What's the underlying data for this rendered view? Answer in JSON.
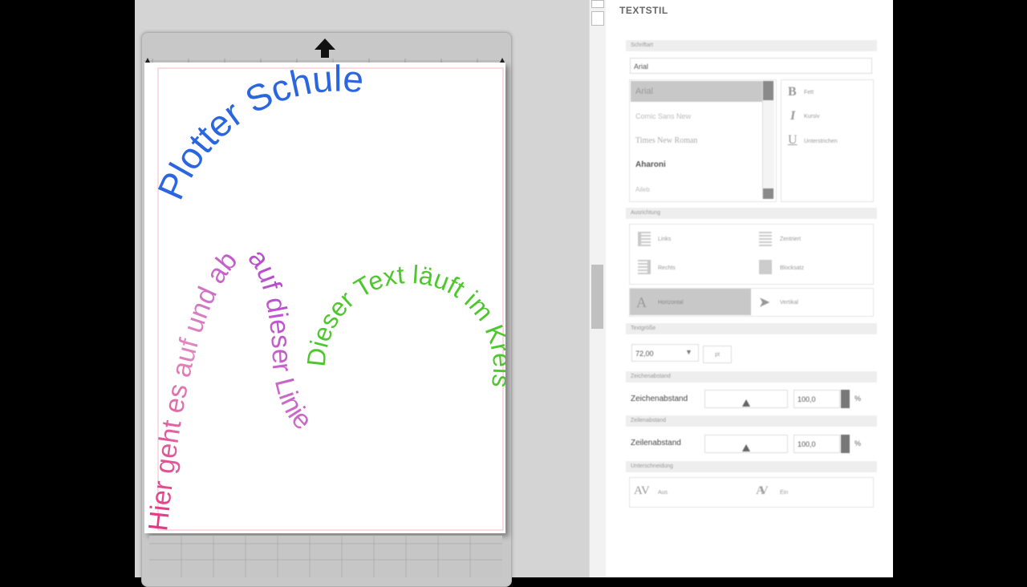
{
  "canvas": {
    "texts": [
      {
        "text": "Plotter Schule",
        "color": "#2a66e0"
      },
      {
        "text": "Dieser Text läuft im Kreis",
        "color": "#4cc82c"
      },
      {
        "text": "Hier geht es auf und ab auf dieser Linie",
        "color": "#e0307a"
      }
    ]
  },
  "panel": {
    "title": "TEXTSTIL",
    "schrift": {
      "header": "Schriftart",
      "current": "Arial",
      "fonts": [
        "Arial",
        "Comic Sans New",
        "Times New Roman",
        "Aharoni",
        "Aileb"
      ],
      "styles": [
        {
          "icon": "B",
          "label": "Fett"
        },
        {
          "icon": "I",
          "label": "Kursiv"
        },
        {
          "icon": "U",
          "label": "Unterstrichen"
        }
      ]
    },
    "ausrichtung": {
      "header": "Ausrichtung",
      "options": [
        "Links",
        "Zentriert",
        "Rechts",
        "Blocksatz"
      ],
      "directions": [
        "Horizontal",
        "Vertikal"
      ]
    },
    "textgroesse": {
      "header": "Textgröße",
      "value": "72,00",
      "unit": "pt"
    },
    "zeichenabstand": {
      "header": "Zeichenabstand",
      "label": "Zeichenabstand",
      "value": "100,0",
      "unit": "%"
    },
    "zeilenabstand": {
      "header": "Zeilenabstand",
      "label": "Zeilenabstand",
      "value": "100,0",
      "unit": "%"
    },
    "unterschneidung": {
      "header": "Unterschneidung",
      "options": [
        "Aus",
        "Ein"
      ]
    }
  }
}
